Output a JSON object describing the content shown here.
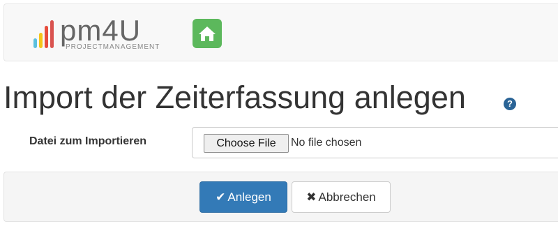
{
  "brand": {
    "name": "pm4U",
    "tagline": "PROJECTMANAGEMENT"
  },
  "nav": {
    "home_icon": "home-icon"
  },
  "page": {
    "title": "Import der Zeiterfassung anlegen",
    "help_icon": "?"
  },
  "form": {
    "file_label": "Datei zum Importieren",
    "choose_button": "Choose File",
    "file_status": "No file chosen"
  },
  "actions": {
    "submit_icon": "✔",
    "submit_label": "Anlegen",
    "cancel_icon": "✖",
    "cancel_label": "Abbrechen"
  },
  "colors": {
    "logo_bars": [
      "#f5c518",
      "#5bc0de",
      "#e74c3c",
      "#d9534f"
    ],
    "home_button": "#5cb85c",
    "primary": "#337ab7",
    "help_icon": "#2a6496"
  }
}
